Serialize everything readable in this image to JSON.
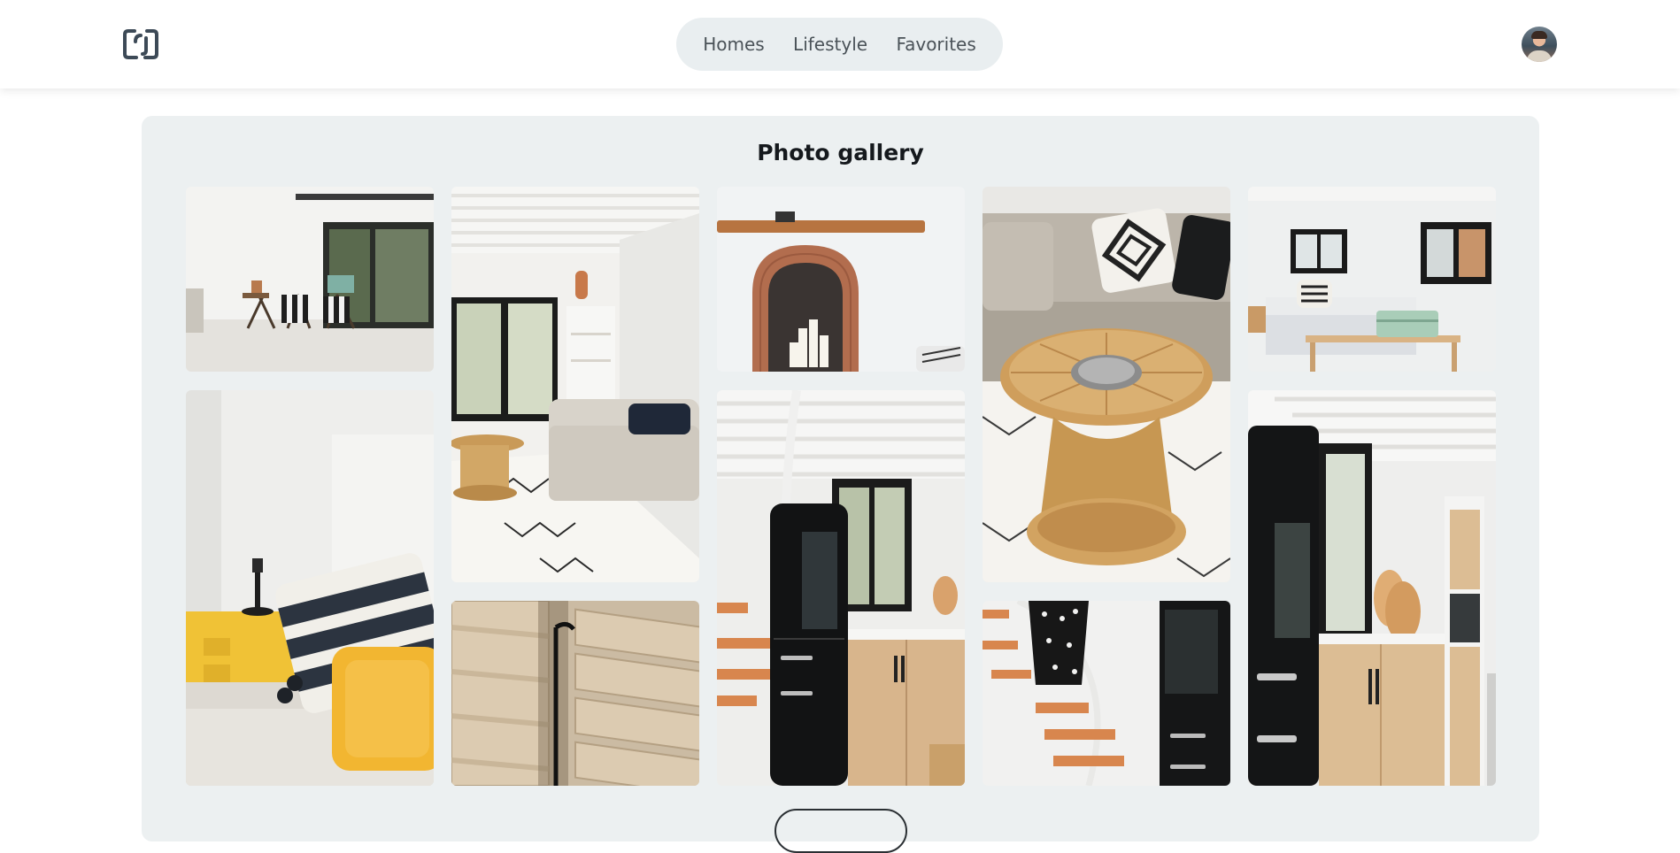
{
  "header": {
    "logo": "logo-icon",
    "nav": [
      {
        "label": "Homes"
      },
      {
        "label": "Lifestyle"
      },
      {
        "label": "Favorites"
      }
    ],
    "avatar": "user-avatar"
  },
  "gallery": {
    "title": "Photo gallery",
    "photos": [
      {
        "subject": "patio-deck-chairs"
      },
      {
        "subject": "living-room-sofa"
      },
      {
        "subject": "brick-fireplace"
      },
      {
        "subject": "rattan-table-sofa"
      },
      {
        "subject": "bedroom-windows"
      },
      {
        "subject": "bed-yellow-pillow"
      },
      {
        "subject": "wooden-shutters"
      },
      {
        "subject": "kitchen-black-fridge"
      },
      {
        "subject": "spiral-staircase"
      },
      {
        "subject": "kitchen-wide"
      }
    ]
  }
}
